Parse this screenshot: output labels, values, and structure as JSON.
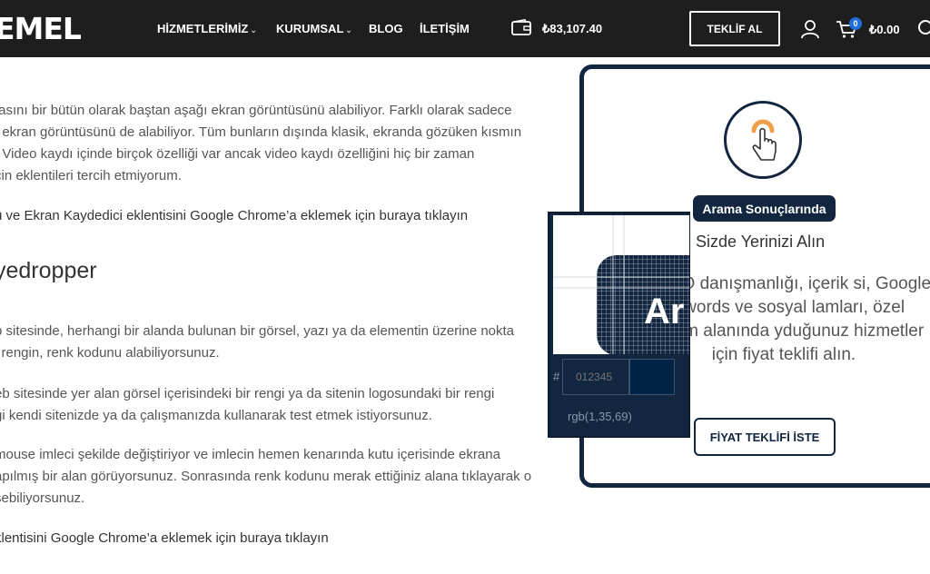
{
  "header": {
    "logo": "EMEL",
    "nav": [
      {
        "label": "HİZMETLERİMİZ",
        "has_dropdown": true
      },
      {
        "label": "KURUMSAL",
        "has_dropdown": true
      },
      {
        "label": "BLOG",
        "has_dropdown": false
      },
      {
        "label": "İLETİŞİM",
        "has_dropdown": false
      }
    ],
    "wallet_amount": "₺83,107.40",
    "quote_button": "TEKLİF AL",
    "cart_count": "0",
    "cart_amount": "₺0.00",
    "icons": {
      "wallet": "wallet-icon",
      "user": "user-icon",
      "cart": "cart-icon",
      "search": "search-icon"
    },
    "colors": {
      "bar": "#1e1e1e",
      "badge": "#1e6fd9"
    }
  },
  "article": {
    "paragraph1": [
      "fasını bir bütün olarak baştan aşağı ekran görüntüsünü alabiliyor. Farklı olarak sadece",
      "ı ekran görüntüsünü de alabiliyor. Tüm bunların dışında klasik, ekranda gözüken kısmın",
      ". Video kaydı içinde birçok özelliği var ancak video kaydı özelliğini hiç bir zaman",
      "çin eklentileri tercih etmiyorum."
    ],
    "link1": "ü ve Ekran Kaydedici eklentisini Google Chrome’a eklemek için buraya tıklayın",
    "heading": "yedropper",
    "paragraph2": [
      "b sitesinde, herhangi bir alanda bulunan bir görsel, yazı ya da elementin üzerine nokta",
      "i rengin, renk kodunu alabiliyorsunuz."
    ],
    "paragraph3": [
      "eb sitesinde yer alan görsel içerisindeki bir rengi ya da sitenin logosundaki bir rengi",
      "gi kendi sitenizde ya da çalışmanızda kullanarak test etmek istiyorsunuz."
    ],
    "paragraph4": [
      "mouse imleci şekilde değiştiriyor ve imlecin hemen kenarında kutu içerisinde ekrana",
      "apılmış bir alan görüyorsunuz. Sonrasında renk kodunu merak ettiğiniz alana tıklayarak o",
      "şebiliyorsunuz."
    ],
    "link2": "klentisini Google Chrome’a eklemek için buraya tıklayın"
  },
  "promo_card": {
    "icon": "pointer-hand-icon",
    "badge": "Arama Sonuçlarında",
    "subtitle": "Sizde Yerinizi Alın",
    "description": "si, SEO danışmanlığı, içerik si, Google Adwords ve sosyal lamları, özel yazılım alanında yduğunuz hizmetler için fiyat teklifi alın.",
    "cta": "FİYAT TEKLİFİ İSTE",
    "colors": {
      "border": "#12263f",
      "accent": "#f0a04b"
    }
  },
  "eyedropper": {
    "magnified_text": "Ar",
    "hash": "#",
    "hex_placeholder": "012345",
    "rgb": "rgb(1,35,69)",
    "swatch_color": "#012345"
  }
}
